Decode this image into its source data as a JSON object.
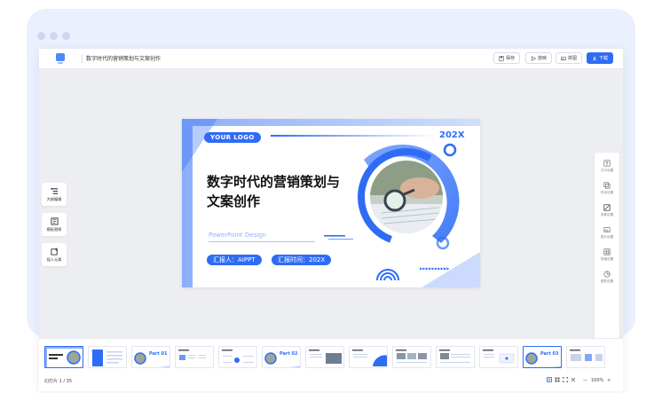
{
  "document": {
    "title": "数字时代的营销策划与文案创作"
  },
  "toolbar": {
    "save_label": "保存",
    "present_label": "放映",
    "image_label": "拼图",
    "download_label": "下载"
  },
  "left_tools": [
    {
      "label": "大纲编辑",
      "icon": "outline-icon"
    },
    {
      "label": "模板替换",
      "icon": "template-icon"
    },
    {
      "label": "插入元素",
      "icon": "insert-icon"
    }
  ],
  "right_panel": [
    {
      "label": "文字设置",
      "icon": "text-icon"
    },
    {
      "label": "形状设置",
      "icon": "shape-icon"
    },
    {
      "label": "背景设置",
      "icon": "background-icon"
    },
    {
      "label": "图片设置",
      "icon": "image-icon"
    },
    {
      "label": "表格设置",
      "icon": "table-icon"
    },
    {
      "label": "图表设置",
      "icon": "chart-icon"
    }
  ],
  "slide": {
    "logo": "YOUR LOGO",
    "year": "202X",
    "title_line1": "数字时代的营销策划与",
    "title_line2": "文案创作",
    "subtitle": "PowerPoint Design",
    "reporter": "汇报人：AIPPT",
    "report_time": "汇报时间：202X",
    "arrows": "▶▶▶▶▶▶▶▶▶▶"
  },
  "filmstrip": {
    "thumbnails": [
      {
        "label": ""
      },
      {
        "label": ""
      },
      {
        "label": "Part 01"
      },
      {
        "label": ""
      },
      {
        "label": ""
      },
      {
        "label": "Part 02"
      },
      {
        "label": ""
      },
      {
        "label": ""
      },
      {
        "label": ""
      },
      {
        "label": ""
      },
      {
        "label": ""
      },
      {
        "label": "Part 03"
      },
      {
        "label": ""
      }
    ],
    "slide_counter": "幻灯片 1 / 35",
    "zoom": "100%",
    "zoom_out": "—",
    "zoom_in": "+"
  },
  "colors": {
    "accent": "#2f6cf6",
    "background": "#edeef2"
  }
}
